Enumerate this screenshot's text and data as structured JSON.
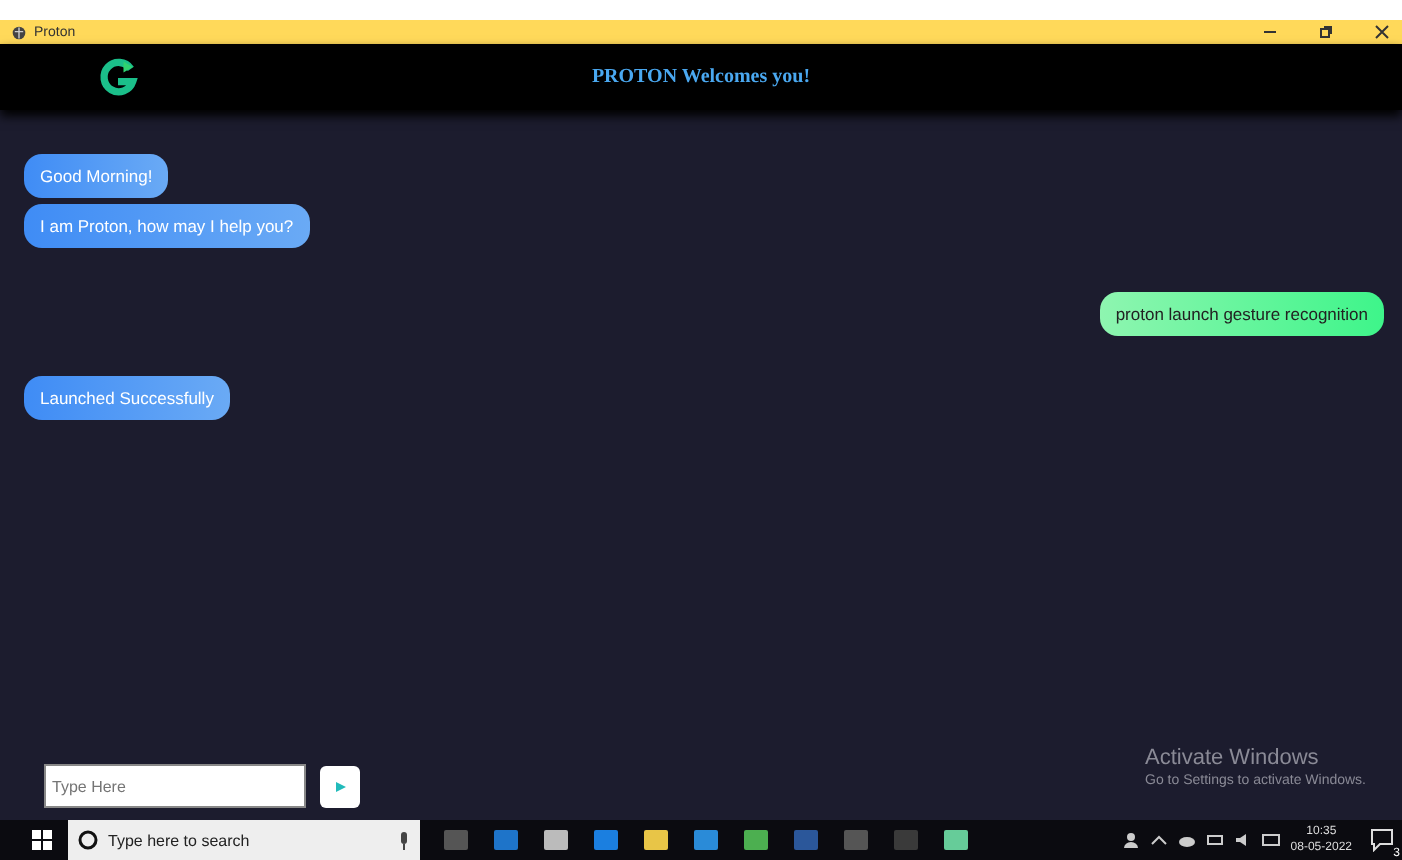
{
  "window": {
    "title": "Proton"
  },
  "header": {
    "title": "PROTON Welcomes you!"
  },
  "messages": [
    {
      "kind": "bot",
      "text": "Good Morning!"
    },
    {
      "kind": "bot",
      "text": "I am Proton, how may I help you?"
    },
    {
      "kind": "user",
      "text": "proton launch gesture recognition"
    },
    {
      "kind": "bot",
      "text": "Launched Successfully"
    }
  ],
  "input": {
    "placeholder": "Type Here"
  },
  "activation": {
    "title": "Activate Windows",
    "subtitle": "Go to Settings to activate Windows."
  },
  "taskbar": {
    "search_placeholder": "Type here to search",
    "time": "10:35",
    "date": "08-05-2022",
    "notifications": "3"
  }
}
